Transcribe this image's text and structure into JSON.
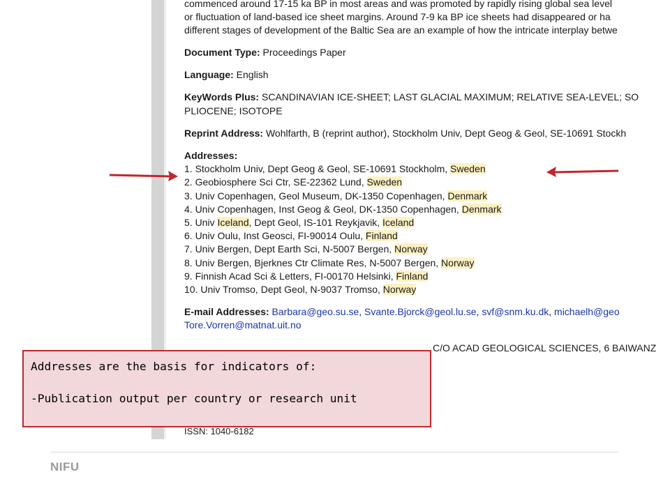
{
  "record": {
    "abstract_lines": [
      "commenced around 17-15 ka BP in most areas and was promoted by rapidly rising global sea level",
      "or fluctuation of land-based ice sheet margins. Around 7-9 ka BP ice sheets had disappeared or ha",
      "different stages of development of the Baltic Sea are an example of how the intricate interplay betwe"
    ],
    "document_type": {
      "label": "Document Type:",
      "value": " Proceedings Paper"
    },
    "language": {
      "label": "Language:",
      "value": " English"
    },
    "keywords_plus": {
      "label": "KeyWords Plus:",
      "value_line1": " SCANDINAVIAN ICE-SHEET; LAST GLACIAL MAXIMUM; RELATIVE SEA-LEVEL; SO",
      "value_line2": "PLIOCENE; ISOTOPE"
    },
    "reprint_address": {
      "label": "Reprint Address:",
      "value": " Wohlfarth, B (reprint author), Stockholm Univ, Dept Geog & Geol, SE-10691 Stockh"
    },
    "addresses": {
      "label": "Addresses:",
      "items": [
        {
          "pre": "1. Stockholm Univ, Dept Geog & Geol, SE-10691 Stockholm, ",
          "hl1": "Sweden",
          "mid": "",
          "hl2": ""
        },
        {
          "pre": "2. Geobiosphere Sci Ctr, SE-22362 Lund, ",
          "hl1": "Sweden",
          "mid": "",
          "hl2": ""
        },
        {
          "pre": "3. Univ Copenhagen, Geol Museum, DK-1350 Copenhagen, ",
          "hl1": "Denmark",
          "mid": "",
          "hl2": ""
        },
        {
          "pre": "4. Univ Copenhagen, Inst Geog & Geol, DK-1350 Copenhagen, ",
          "hl1": "Denmark",
          "mid": "",
          "hl2": ""
        },
        {
          "pre": "5. Univ ",
          "hl1": "Iceland",
          "mid": ", Dept Geol, IS-101 Reykjavik, ",
          "hl2": "Iceland"
        },
        {
          "pre": "6. Univ Oulu, Inst Geosci, FI-90014 Oulu, ",
          "hl1": "Finland",
          "mid": "",
          "hl2": ""
        },
        {
          "pre": "7. Univ Bergen, Dept Earth Sci, N-5007 Bergen, ",
          "hl1": "Norway",
          "mid": "",
          "hl2": ""
        },
        {
          "pre": "8. Univ Bergen, Bjerknes Ctr Climate Res, N-5007 Bergen, ",
          "hl1": "Norway",
          "mid": "",
          "hl2": ""
        },
        {
          "pre": "9. Finnish Acad Sci & Letters, FI-00170 Helsinki, ",
          "hl1": "Finland",
          "mid": "",
          "hl2": ""
        },
        {
          "pre": "10. Univ Tromso, Dept Geol, N-9037 Tromso, ",
          "hl1": "Norway",
          "mid": "",
          "hl2": ""
        }
      ]
    },
    "email_addresses": {
      "label": "E-mail Addresses:",
      "line1_links": [
        "Barbara@geo.su.se",
        "Svante.Bjorck@geol.lu.se",
        "svf@snm.ku.dk",
        "michaelh@geo"
      ],
      "line2_link": "Tore.Vorren@matnat.uit.no"
    },
    "publisher_partial": "C/O ACAD GEOLOGICAL SCIENCES, 6 BAIWANZ",
    "bottom_partial": "ISSN: 1040-6182"
  },
  "annotation": {
    "line1": "Addresses are the basis for indicators of:",
    "line2": "-Publication output per country or research unit",
    "arrow_color": "#c0272d",
    "fill_color": "#f2d8db"
  },
  "footer": {
    "logo": "NIFU"
  }
}
